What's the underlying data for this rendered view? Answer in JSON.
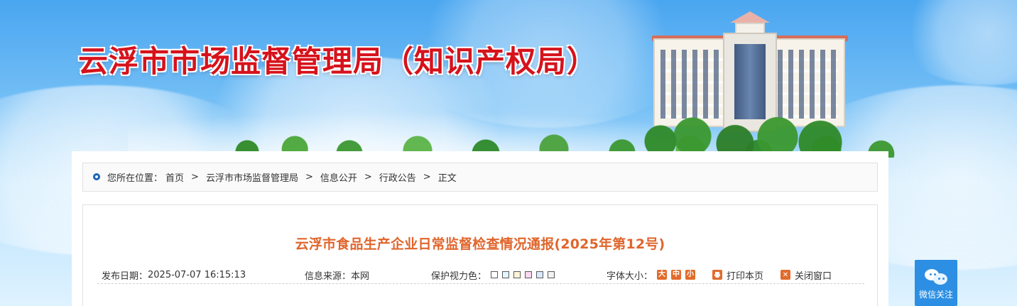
{
  "header": {
    "site_title": "云浮市市场监督管理局（知识产权局）"
  },
  "breadcrumb": {
    "prefix": "您所在位置：",
    "items": [
      "首页",
      "云浮市市场监督管理局",
      "信息公开",
      "行政公告",
      "正文"
    ],
    "separator": ">"
  },
  "article": {
    "title": "云浮市食品生产企业日常监督检查情况通报(2025年第12号)",
    "meta": {
      "published_label": "发布日期：",
      "published_value": "2025-07-07 16:15:13",
      "source_label": "信息来源：",
      "source_value": "本网",
      "eye_color_label": "保护视力色：",
      "eye_colors": [
        "#ffffff",
        "#e6f7ff",
        "#fff6d6",
        "#ffd7f2",
        "#d8e8ff",
        "#f2f2f2"
      ],
      "font_size_label": "字体大小：",
      "font_size_buttons": [
        "大",
        "中",
        "小"
      ],
      "print_label": "打印本页",
      "close_label": "关闭窗口"
    }
  },
  "wechat_follow": {
    "label": "微信关注"
  },
  "colors": {
    "title_red": "#d6121b",
    "article_orange": "#e0652c",
    "accent_orange": "#e26b2b",
    "breadcrumb_icon_blue": "#1a63b6",
    "wechat_blue": "#2c8fe3"
  },
  "icons": {
    "breadcrumb": "location-pin-icon",
    "print": "print-icon",
    "close": "close-window-icon",
    "wechat": "wechat-icon"
  }
}
